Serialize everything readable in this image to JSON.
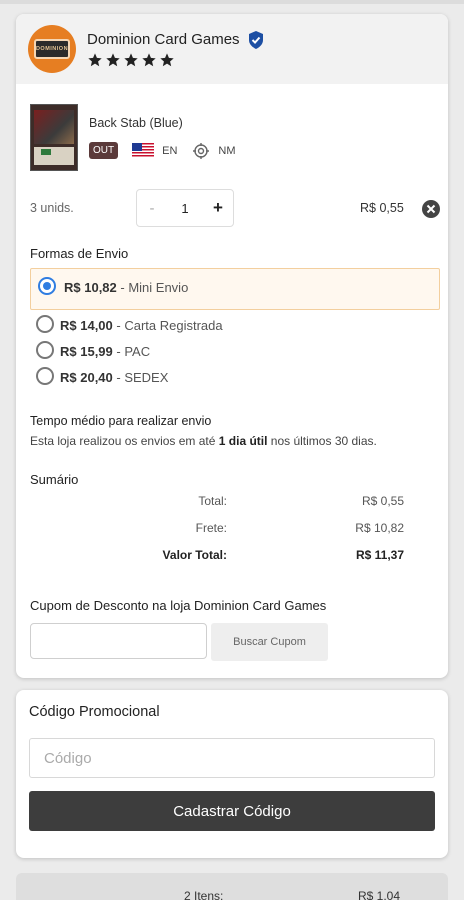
{
  "store": {
    "logo_text": "DOMINION",
    "name": "Dominion Card Games",
    "rating": 5
  },
  "item": {
    "name": "Back Stab (Blue)",
    "stock_badge": "OUT",
    "language": "EN",
    "condition": "NM",
    "units": "3 unids.",
    "quantity": "1",
    "minus": "-",
    "plus": "+",
    "price": "R$ 0,55"
  },
  "shipping": {
    "title": "Formas de Envio",
    "options": [
      {
        "price": "R$ 10,82",
        "name": "- Mini Envio",
        "selected": true
      },
      {
        "price": "R$ 14,00",
        "name": "- Carta Registrada",
        "selected": false
      },
      {
        "price": "R$ 15,99",
        "name": "- PAC",
        "selected": false
      },
      {
        "price": "R$ 20,40",
        "name": "- SEDEX",
        "selected": false
      }
    ]
  },
  "avg_time": {
    "title": "Tempo médio para realizar envio",
    "desc_pre": "Esta loja realizou os envios em até ",
    "desc_bold": "1 dia útil",
    "desc_post": " nos últimos 30 dias."
  },
  "summary": {
    "title": "Sumário",
    "rows": [
      {
        "label": "Total:",
        "value": "R$ 0,55"
      },
      {
        "label": "Frete:",
        "value": "R$ 10,82"
      },
      {
        "label": "Valor Total:",
        "value": "R$ 11,37"
      }
    ]
  },
  "coupon": {
    "title": "Cupom de Desconto na loja Dominion Card Games",
    "input_value": "",
    "button": "Buscar Cupom"
  },
  "promo": {
    "title": "Código Promocional",
    "placeholder": "Código",
    "button": "Cadastrar Código"
  },
  "footer": {
    "items": "2 Itens:",
    "total": "R$ 1,04"
  },
  "colors": {
    "accent": "#2f7de1",
    "star": "#222222",
    "verified": "#1d4fa3",
    "selected_bg": "#fff8ef",
    "button_dark": "#3d3d3d"
  }
}
